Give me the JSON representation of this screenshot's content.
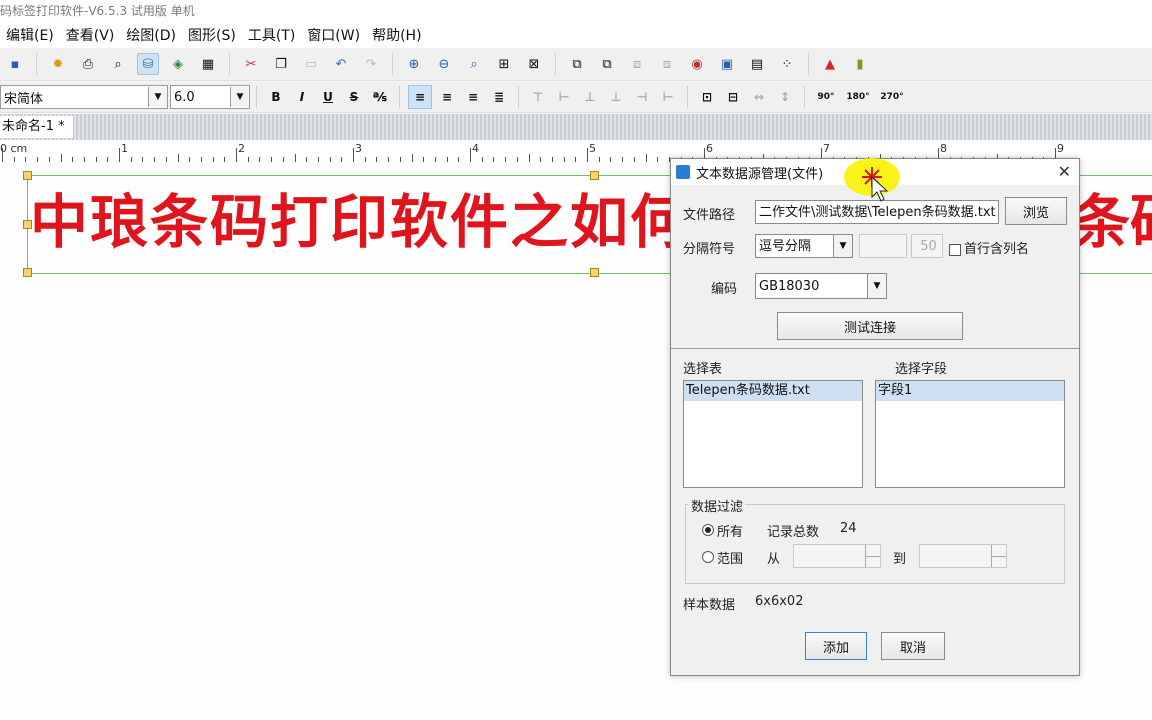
{
  "window": {
    "title": "码标签打印软件-V6.5.3 试用版 单机"
  },
  "menu": [
    "编辑(E)",
    "查看(V)",
    "绘图(D)",
    "图形(S)",
    "工具(T)",
    "窗口(W)",
    "帮助(H)"
  ],
  "format_toolbar": {
    "font_name": "宋简体",
    "font_size": "6.0",
    "bold": "B",
    "italic": "I",
    "underline": "U",
    "strike": "S",
    "rot90": "90°",
    "rot180": "180°",
    "rot270": "270°"
  },
  "document": {
    "tab_label": "未命名-1 *"
  },
  "ruler": {
    "unit": "0 cm",
    "ticks": [
      "1",
      "2",
      "3",
      "4",
      "5",
      "6",
      "7",
      "8",
      "9"
    ]
  },
  "canvas": {
    "label_text_left": "中琅条码打印软件之如何批",
    "label_text_right": "条码"
  },
  "dialog": {
    "title": "文本数据源管理(文件)",
    "file_path_label": "文件路径",
    "file_path_value": "二作文件\\测试数据\\Telepen条码数据.txt",
    "browse_button": "浏览",
    "separator_label": "分隔符号",
    "separator_value": "逗号分隔",
    "separator_extra_value": "50",
    "first_row_header_label": "首行含列名",
    "encoding_label": "编码",
    "encoding_value": "GB18030",
    "test_connect_button": "测试连接",
    "select_table_label": "选择表",
    "select_field_label": "选择字段",
    "tables": [
      "Telepen条码数据.txt"
    ],
    "fields": [
      "字段1"
    ],
    "filter_group_label": "数据过滤",
    "filter_all_label": "所有",
    "record_total_label": "记录总数",
    "record_total_value": "24",
    "filter_range_label": "范围",
    "from_label": "从",
    "to_label": "到",
    "sample_label": "样本数据",
    "sample_value": "6x6x02",
    "add_button": "添加",
    "cancel_button": "取消"
  },
  "colors": {
    "label_text": "#e0141c",
    "selection_border": "#6fbf6f",
    "list_selection": "#cfe0f4"
  }
}
